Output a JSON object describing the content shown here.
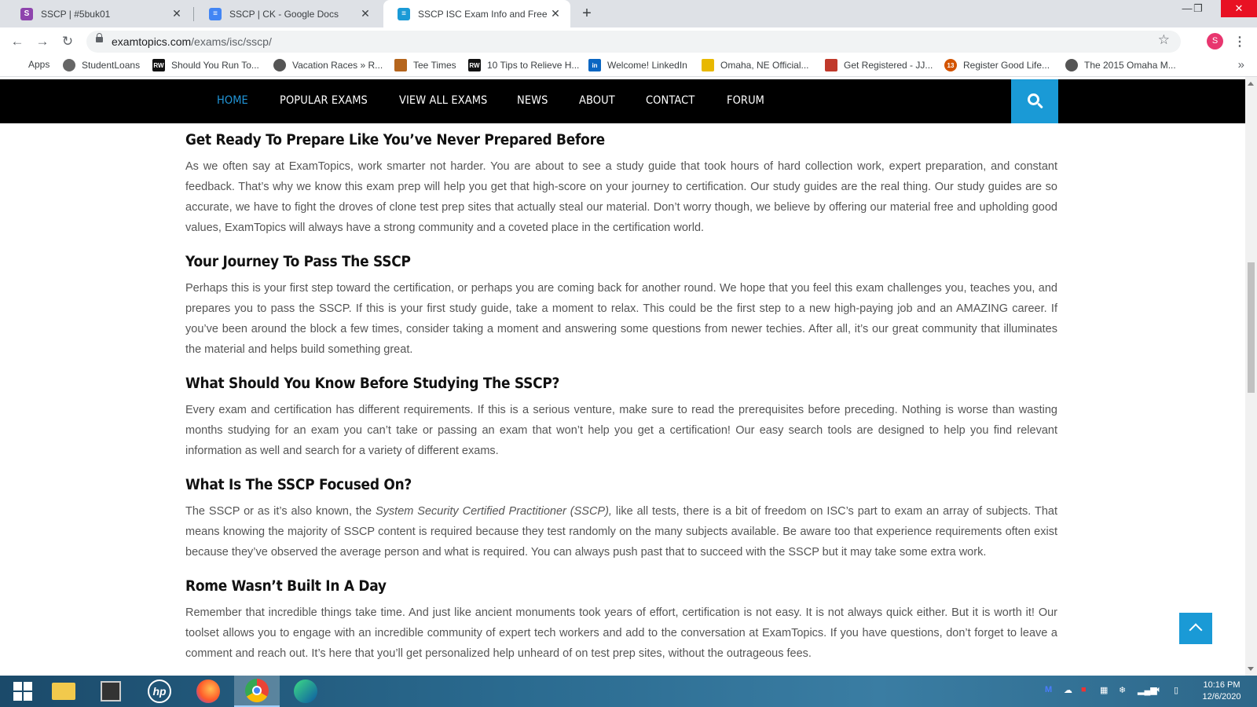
{
  "browser": {
    "tabs": [
      {
        "title": "SSCP | #5buk01",
        "active": false,
        "favicon_color": "#8e44ad"
      },
      {
        "title": "SSCP | CK - Google Docs",
        "active": false,
        "favicon_color": "#4285f4"
      },
      {
        "title": "SSCP ISC Exam Info and Free Pra",
        "active": true,
        "favicon_color": "#1a9ad6"
      }
    ],
    "url_host": "examtopics.com",
    "url_path": "/exams/isc/sscp/",
    "profile_initial": "S",
    "bookmarks": [
      {
        "label": "Apps",
        "icon": "apps-grid-icon",
        "color": "#4285f4"
      },
      {
        "label": "StudentLoans",
        "icon": "globe-icon",
        "color": "#555555"
      },
      {
        "label": "Should You Run To...",
        "icon": "rw-icon",
        "color": "#111111"
      },
      {
        "label": "Vacation Races » R...",
        "icon": "globe-icon",
        "color": "#555555"
      },
      {
        "label": "Tee Times",
        "icon": "golf-icon",
        "color": "#b5651d"
      },
      {
        "label": "10 Tips to Relieve H...",
        "icon": "rw-icon",
        "color": "#111111"
      },
      {
        "label": "Welcome! LinkedIn",
        "icon": "linkedin-icon",
        "color": "#0a66c2"
      },
      {
        "label": "Omaha, NE Official...",
        "icon": "omaha-icon",
        "color": "#e8b800"
      },
      {
        "label": "Get Registered - JJ...",
        "icon": "register-icon",
        "color": "#c0392b"
      },
      {
        "label": "Register Good Life...",
        "icon": "131-icon",
        "color": "#d35400"
      },
      {
        "label": "The 2015 Omaha M...",
        "icon": "globe-icon",
        "color": "#555555"
      }
    ]
  },
  "site": {
    "nav": [
      {
        "label": "HOME",
        "active": true
      },
      {
        "label": "POPULAR EXAMS",
        "active": false
      },
      {
        "label": "VIEW ALL EXAMS",
        "active": false
      },
      {
        "label": "NEWS",
        "active": false
      },
      {
        "label": "ABOUT",
        "active": false
      },
      {
        "label": "CONTACT",
        "active": false
      },
      {
        "label": "FORUM",
        "active": false
      }
    ],
    "accent_color": "#1a9ad6"
  },
  "article": {
    "sections": [
      {
        "heading": "Get Ready To Prepare Like You’ve Never Prepared Before",
        "body": "As we often say at ExamTopics, work smarter not harder. You are about to see a study guide that took hours of hard collection work, expert preparation, and constant feedback. That’s why we know this exam prep will help you get that high-score on your journey to certification. Our study guides are the real thing. Our study guides are so accurate, we have to fight the droves of clone test prep sites that actually steal our material. Don’t worry though, we believe by offering our material free and upholding good values, ExamTopics will always have a strong community and a coveted place in the certification world."
      },
      {
        "heading": "Your Journey To Pass The SSCP",
        "body": "Perhaps this is your first step toward the certification, or perhaps you are coming back for another round. We hope that you feel this exam challenges you, teaches you, and prepares you to pass the SSCP. If this is your first study guide, take a moment to relax. This could be the first step to a new high-paying job and an AMAZING career. If you’ve been around the block a few times, consider taking a moment and answering some questions from newer techies. After all, it’s our great community that illuminates the material and helps build something great."
      },
      {
        "heading": "What Should You Know Before Studying The SSCP?",
        "body": "Every exam and certification has different requirements. If this is a serious venture, make sure to read the prerequisites before preceding. Nothing is worse than wasting months studying for an exam you can’t take or passing an exam that won’t help you get a certification! Our easy search tools are designed to help you find relevant information as well and search for a variety of different exams."
      },
      {
        "heading": "What Is The SSCP Focused On?",
        "body_before": "The SSCP or as it’s also known, the ",
        "body_em": "System Security Certified Practitioner (SSCP),",
        "body_after": " like all tests, there is a bit of freedom on ISC’s part to exam an array of subjects. That means knowing the majority of SSCP content is required because they test randomly on the many subjects available. Be aware too that experience requirements often exist because they’ve observed the average person and what is required. You can always push past that to succeed with the SSCP but it may take some extra work."
      },
      {
        "heading": "Rome Wasn’t Built In A Day",
        "body": "Remember that incredible things take time. And just like ancient monuments took years of effort, certification is not easy. It is not always quick either. But it is worth it! Our toolset allows you to engage with an incredible community of expert tech workers and add to the conversation at ExamTopics. If you have questions, don’t forget to leave a comment and reach out. It’s here that you’ll get personalized help unheard of on test prep sites, without the outrageous fees."
      }
    ]
  },
  "taskbar": {
    "time": "10:16 PM",
    "date": "12/6/2020"
  }
}
